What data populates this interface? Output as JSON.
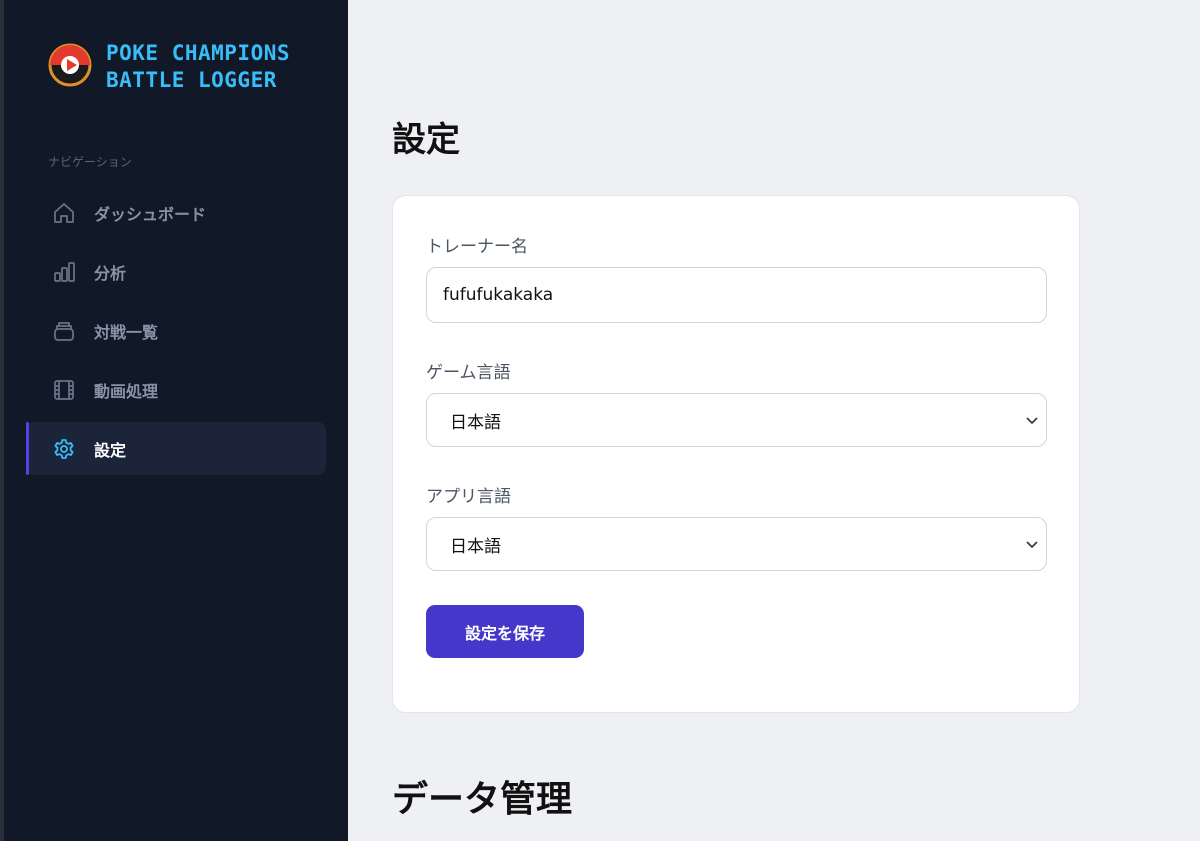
{
  "app": {
    "title_line1": "POKE CHAMPIONS",
    "title_line2": "BATTLE LOGGER"
  },
  "sidebar": {
    "section_label": "ナビゲーション",
    "items": [
      {
        "label": "ダッシュボード",
        "icon": "home-icon",
        "active": false
      },
      {
        "label": "分析",
        "icon": "bar-chart-icon",
        "active": false
      },
      {
        "label": "対戦一覧",
        "icon": "stack-icon",
        "active": false
      },
      {
        "label": "動画処理",
        "icon": "film-icon",
        "active": false
      },
      {
        "label": "設定",
        "icon": "gear-icon",
        "active": true
      }
    ]
  },
  "main": {
    "title": "設定",
    "settings": {
      "trainer_name_label": "トレーナー名",
      "trainer_name_value": "fufufukakaka",
      "game_language_label": "ゲーム言語",
      "game_language_value": "日本語",
      "app_language_label": "アプリ言語",
      "app_language_value": "日本語",
      "save_label": "設定を保存"
    },
    "data_section_title": "データ管理"
  },
  "colors": {
    "sidebar_bg": "#111827",
    "brand_text": "#38bdf8",
    "accent": "#4338ca",
    "active_icon": "#38bdf8"
  }
}
